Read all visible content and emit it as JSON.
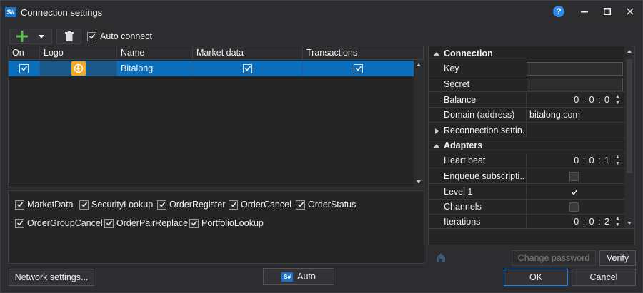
{
  "window": {
    "title": "Connection settings",
    "app_icon_text": "S#"
  },
  "toolbar": {
    "auto_connect_label": "Auto connect",
    "auto_connect_checked": true
  },
  "grid": {
    "columns": [
      "On",
      "Logo",
      "Name",
      "Market data",
      "Transactions"
    ],
    "rows": [
      {
        "on": true,
        "name": "Bitalong",
        "market_data": true,
        "transactions": true,
        "selected": true
      }
    ]
  },
  "messages": [
    {
      "label": "MarketData",
      "checked": true
    },
    {
      "label": "SecurityLookup",
      "checked": true
    },
    {
      "label": "OrderRegister",
      "checked": true
    },
    {
      "label": "OrderCancel",
      "checked": true
    },
    {
      "label": "OrderStatus",
      "checked": true
    },
    {
      "label": "OrderGroupCancel",
      "checked": true
    },
    {
      "label": "OrderPairReplace",
      "checked": true
    },
    {
      "label": "PortfolioLookup",
      "checked": true
    }
  ],
  "properties": {
    "connection_category": "Connection",
    "key_label": "Key",
    "key_value": "",
    "secret_label": "Secret",
    "secret_value": "",
    "balance_label": "Balance",
    "balance_value": "0 : 0 : 0",
    "domain_label": "Domain (address)",
    "domain_value": "bitalong.com",
    "reconnection_label": "Reconnection settin...",
    "adapters_category": "Adapters",
    "heartbeat_label": "Heart beat",
    "heartbeat_value": "0 : 0 : 1",
    "enqueue_label": "Enqueue subscripti...",
    "enqueue_checked": false,
    "level1_label": "Level 1",
    "level1_checked": true,
    "channels_label": "Channels",
    "channels_checked": false,
    "iterations_label": "Iterations",
    "iterations_value": "0 : 0 : 2",
    "change_password_label": "Change password",
    "verify_label": "Verify"
  },
  "footer": {
    "network_settings_label": "Network settings...",
    "auto_label": "Auto",
    "auto_icon_text": "S#",
    "ok_label": "OK",
    "cancel_label": "Cancel"
  },
  "colors": {
    "background": "#2d2d30",
    "panel": "#252526",
    "selection": "#0a6ebd",
    "accent": "#1e73c8",
    "logo_orange": "#f5a623",
    "add_green": "#5cc34a"
  }
}
